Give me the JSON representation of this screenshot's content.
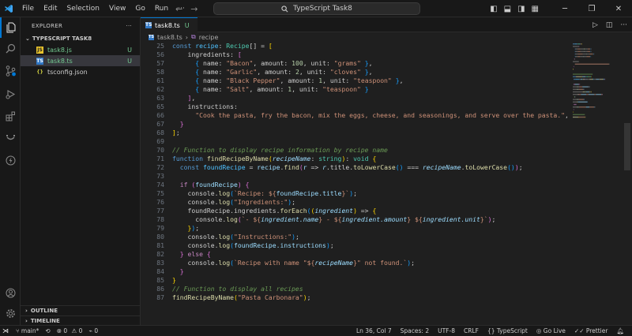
{
  "titlebar": {
    "menu": [
      "File",
      "Edit",
      "Selection",
      "View",
      "Go",
      "Run"
    ],
    "more": "···",
    "search_text": "TypeScript Task8"
  },
  "sidebar": {
    "title": "EXPLORER",
    "more": "···",
    "project": "TYPESCRIPT TASK8",
    "files": [
      {
        "name": "task8.js",
        "badge": "U",
        "icon": "js-file-icon"
      },
      {
        "name": "task8.ts",
        "badge": "U",
        "icon": "ts-file-icon"
      },
      {
        "name": "tsconfig.json",
        "badge": "",
        "icon": "json-file-icon"
      }
    ],
    "outline": "OUTLINE",
    "timeline": "TIMELINE"
  },
  "editor": {
    "tab": {
      "name": "task8.ts",
      "modified": "U"
    },
    "breadcrumb": {
      "file": "task8.ts",
      "symbol": "recipe"
    }
  },
  "code_lines": [
    {
      "n": "25",
      "tokens": [
        [
          "const ",
          "k"
        ],
        [
          "recipe",
          "vc"
        ],
        [
          ": ",
          ""
        ],
        [
          "Recipe",
          "t"
        ],
        [
          "[] = ",
          ""
        ],
        [
          "[",
          "b1"
        ]
      ]
    },
    {
      "n": "56",
      "tokens": [
        [
          "    ingredients",
          ""
        ],
        [
          ": ",
          ""
        ],
        [
          "[",
          "b2"
        ]
      ]
    },
    {
      "n": "57",
      "tokens": [
        [
          "      ",
          ""
        ],
        [
          "{",
          "b3"
        ],
        [
          " name: ",
          ""
        ],
        [
          "\"Bacon\"",
          "s"
        ],
        [
          ", amount: ",
          ""
        ],
        [
          "100",
          "n"
        ],
        [
          ", unit: ",
          ""
        ],
        [
          "\"grams\"",
          "s"
        ],
        [
          " ",
          ""
        ],
        [
          "}",
          "b3"
        ],
        [
          ",",
          ""
        ]
      ]
    },
    {
      "n": "58",
      "tokens": [
        [
          "      ",
          ""
        ],
        [
          "{",
          "b3"
        ],
        [
          " name: ",
          ""
        ],
        [
          "\"Garlic\"",
          "s"
        ],
        [
          ", amount: ",
          ""
        ],
        [
          "2",
          "n"
        ],
        [
          ", unit: ",
          ""
        ],
        [
          "\"cloves\"",
          "s"
        ],
        [
          " ",
          ""
        ],
        [
          "}",
          "b3"
        ],
        [
          ",",
          ""
        ]
      ]
    },
    {
      "n": "61",
      "tokens": [
        [
          "      ",
          ""
        ],
        [
          "{",
          "b3"
        ],
        [
          " name: ",
          ""
        ],
        [
          "\"Black Pepper\"",
          "s"
        ],
        [
          ", amount: ",
          ""
        ],
        [
          "1",
          "n"
        ],
        [
          ", unit: ",
          ""
        ],
        [
          "\"teaspoon\"",
          "s"
        ],
        [
          " ",
          ""
        ],
        [
          "}",
          "b3"
        ],
        [
          ",",
          ""
        ]
      ]
    },
    {
      "n": "62",
      "tokens": [
        [
          "      ",
          ""
        ],
        [
          "{",
          "b3"
        ],
        [
          " name: ",
          ""
        ],
        [
          "\"Salt\"",
          "s"
        ],
        [
          ", amount: ",
          ""
        ],
        [
          "1",
          "n"
        ],
        [
          ", unit: ",
          ""
        ],
        [
          "\"teaspoon\"",
          "s"
        ],
        [
          " ",
          ""
        ],
        [
          "}",
          "b3"
        ]
      ]
    },
    {
      "n": "63",
      "tokens": [
        [
          "    ",
          ""
        ],
        [
          "]",
          "b2"
        ],
        [
          ",",
          ""
        ]
      ]
    },
    {
      "n": "65",
      "tokens": [
        [
          "    instructions",
          ""
        ],
        [
          ":",
          ""
        ]
      ]
    },
    {
      "n": "66",
      "tokens": [
        [
          "      ",
          ""
        ],
        [
          "\"Cook the pasta, fry the bacon, mix the eggs, cheese, and seasonings, and serve over the pasta.\"",
          "s"
        ],
        [
          ",",
          ""
        ]
      ]
    },
    {
      "n": "67",
      "tokens": [
        [
          "  ",
          ""
        ],
        [
          "}",
          "b2"
        ]
      ]
    },
    {
      "n": "68",
      "tokens": [
        [
          "]",
          "b1"
        ],
        [
          ";",
          ""
        ]
      ]
    },
    {
      "n": "69",
      "tokens": []
    },
    {
      "n": "70",
      "tokens": [
        [
          "// Function to display recipe information by recipe name",
          "c"
        ]
      ]
    },
    {
      "n": "71",
      "tokens": [
        [
          "function ",
          "k"
        ],
        [
          "findRecipeByName",
          "f"
        ],
        [
          "(",
          "b1"
        ],
        [
          "recipeName",
          "pi"
        ],
        [
          ": ",
          ""
        ],
        [
          "string",
          "t"
        ],
        [
          ")",
          "b1"
        ],
        [
          ": ",
          ""
        ],
        [
          "void",
          "t"
        ],
        [
          " ",
          ""
        ],
        [
          "{",
          "b1"
        ]
      ]
    },
    {
      "n": "72",
      "tokens": [
        [
          "  ",
          ""
        ],
        [
          "const ",
          "k"
        ],
        [
          "foundRecipe",
          "vc"
        ],
        [
          " = ",
          ""
        ],
        [
          "recipe",
          "v"
        ],
        [
          ".",
          ""
        ],
        [
          "find",
          "f"
        ],
        [
          "(",
          "b2"
        ],
        [
          "r",
          "v"
        ],
        [
          " => ",
          ""
        ],
        [
          "r",
          "pi"
        ],
        [
          ".title.",
          ""
        ],
        [
          "toLowerCase",
          "f"
        ],
        [
          "()",
          "b3"
        ],
        [
          " === ",
          ""
        ],
        [
          "recipeName",
          "pi"
        ],
        [
          ".",
          ""
        ],
        [
          "toLowerCase",
          "f"
        ],
        [
          "()",
          "b3"
        ],
        [
          ")",
          "b2"
        ],
        [
          ";",
          ""
        ]
      ]
    },
    {
      "n": "73",
      "tokens": []
    },
    {
      "n": "74",
      "tokens": [
        [
          "  ",
          ""
        ],
        [
          "if ",
          "kc"
        ],
        [
          "(",
          "b2"
        ],
        [
          "foundRecipe",
          "v"
        ],
        [
          ")",
          "b2"
        ],
        [
          " ",
          ""
        ],
        [
          "{",
          "b2"
        ]
      ]
    },
    {
      "n": "75",
      "tokens": [
        [
          "    console.",
          ""
        ],
        [
          "log",
          "f"
        ],
        [
          "(",
          "b3"
        ],
        [
          "`Recipe: ${",
          "s"
        ],
        [
          "foundRecipe.title",
          "v"
        ],
        [
          "}`",
          "s"
        ],
        [
          ")",
          "b3"
        ],
        [
          ";",
          ""
        ]
      ]
    },
    {
      "n": "76",
      "tokens": [
        [
          "    console.",
          ""
        ],
        [
          "log",
          "f"
        ],
        [
          "(",
          "b3"
        ],
        [
          "\"Ingredients:\"",
          "s"
        ],
        [
          ")",
          "b3"
        ],
        [
          ";",
          ""
        ]
      ]
    },
    {
      "n": "77",
      "tokens": [
        [
          "    foundRecipe.ingredients.",
          ""
        ],
        [
          "forEach",
          "f"
        ],
        [
          "(",
          "b3"
        ],
        [
          "(",
          "b1"
        ],
        [
          "ingredient",
          "pi"
        ],
        [
          ")",
          "b1"
        ],
        [
          " => ",
          ""
        ],
        [
          "{",
          "b1"
        ]
      ]
    },
    {
      "n": "78",
      "tokens": [
        [
          "      console.",
          ""
        ],
        [
          "log",
          "f"
        ],
        [
          "(",
          "b2"
        ],
        [
          "`- ${",
          "s"
        ],
        [
          "ingredient.name",
          "pi"
        ],
        [
          "} - ${",
          "s"
        ],
        [
          "ingredient.amount",
          "pi"
        ],
        [
          "} ${",
          "s"
        ],
        [
          "ingredient.unit",
          "pi"
        ],
        [
          "}`",
          "s"
        ],
        [
          ")",
          "b2"
        ],
        [
          ";",
          ""
        ]
      ]
    },
    {
      "n": "79",
      "tokens": [
        [
          "    ",
          ""
        ],
        [
          "}",
          "b1"
        ],
        [
          ")",
          "b3"
        ],
        [
          ";",
          ""
        ]
      ]
    },
    {
      "n": "80",
      "tokens": [
        [
          "    console.",
          ""
        ],
        [
          "log",
          "f"
        ],
        [
          "(",
          "b3"
        ],
        [
          "\"Instructions:\"",
          "s"
        ],
        [
          ")",
          "b3"
        ],
        [
          ";",
          ""
        ]
      ]
    },
    {
      "n": "81",
      "tokens": [
        [
          "    console.",
          ""
        ],
        [
          "log",
          "f"
        ],
        [
          "(",
          "b3"
        ],
        [
          "foundRecipe.instructions",
          "v"
        ],
        [
          ")",
          "b3"
        ],
        [
          ";",
          ""
        ]
      ]
    },
    {
      "n": "82",
      "tokens": [
        [
          "  ",
          ""
        ],
        [
          "}",
          "b2"
        ],
        [
          " ",
          ""
        ],
        [
          "else ",
          "kc"
        ],
        [
          "{",
          "b2"
        ]
      ]
    },
    {
      "n": "83",
      "tokens": [
        [
          "    console.",
          ""
        ],
        [
          "log",
          "f"
        ],
        [
          "(",
          "b3"
        ],
        [
          "`Recipe with name \"${",
          "s"
        ],
        [
          "recipeName",
          "pi"
        ],
        [
          "}\" not found.`",
          "s"
        ],
        [
          ")",
          "b3"
        ],
        [
          ";",
          ""
        ]
      ]
    },
    {
      "n": "84",
      "tokens": [
        [
          "  ",
          ""
        ],
        [
          "}",
          "b2"
        ]
      ]
    },
    {
      "n": "85",
      "tokens": [
        [
          "}",
          "b1"
        ]
      ]
    },
    {
      "n": "86",
      "tokens": [
        [
          "// Function to display all recipes",
          "c"
        ]
      ]
    },
    {
      "n": "87",
      "tokens": [
        [
          "findRecipeByName",
          "f"
        ],
        [
          "(",
          "b1"
        ],
        [
          "\"Pasta Carbonara\"",
          "s"
        ],
        [
          ")",
          "b1"
        ],
        [
          ";",
          ""
        ]
      ]
    }
  ],
  "statusbar": {
    "branch": "main*",
    "errors": "0",
    "warnings": "0",
    "ports": "0",
    "position": "Ln 36, Col 7",
    "spaces": "Spaces: 2",
    "encoding": "UTF-8",
    "eol": "CRLF",
    "language": "TypeScript",
    "golive": "Go Live",
    "prettier": "Prettier"
  },
  "colors": {
    "accent": "#0078d4",
    "modified": "#73c991",
    "ts_blue": "#3178c6"
  }
}
